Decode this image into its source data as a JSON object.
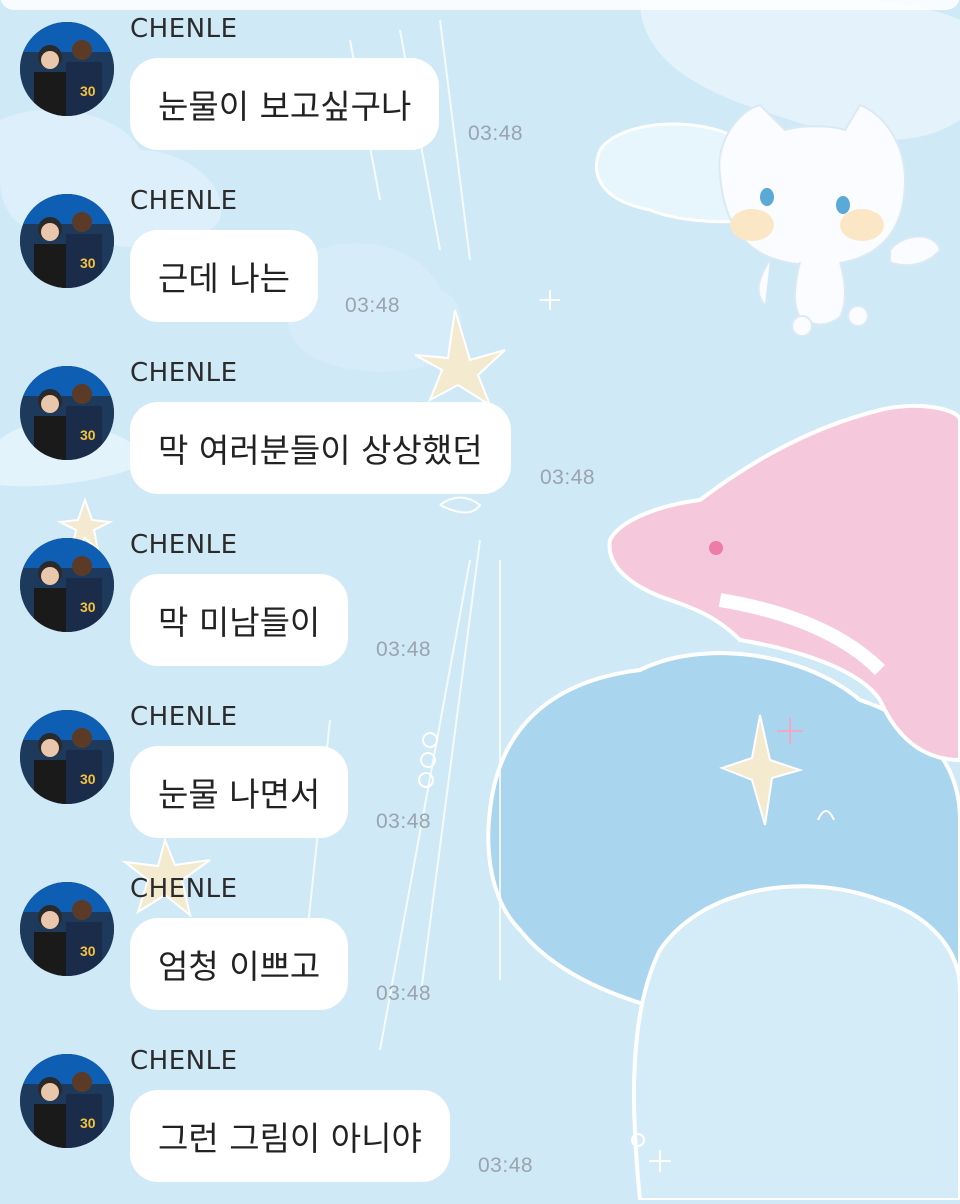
{
  "chat": {
    "messages": [
      {
        "sender": "CHENLE",
        "text": "눈물이 보고싶구나",
        "time": "03:48"
      },
      {
        "sender": "CHENLE",
        "text": "근데 나는",
        "time": "03:48"
      },
      {
        "sender": "CHENLE",
        "text": "막 여러분들이 상상했던",
        "time": "03:48"
      },
      {
        "sender": "CHENLE",
        "text": "막 미남들이",
        "time": "03:48"
      },
      {
        "sender": "CHENLE",
        "text": "눈물 나면서",
        "time": "03:48"
      },
      {
        "sender": "CHENLE",
        "text": "엄청 이쁘고",
        "time": "03:48"
      },
      {
        "sender": "CHENLE",
        "text": "그런 그림이 아니야",
        "time": "03:48"
      }
    ]
  },
  "colors": {
    "background": "#cfe9f7",
    "bubble": "#ffffff",
    "timestamp": "#9aa4ac",
    "dolphin": "#f7c9dc",
    "cloud_dark": "#a9d5ee"
  },
  "icons": {
    "mascot": "white-cat-angel-icon",
    "dolphin": "pink-dolphin-icon",
    "star": "yellow-star-icon"
  }
}
